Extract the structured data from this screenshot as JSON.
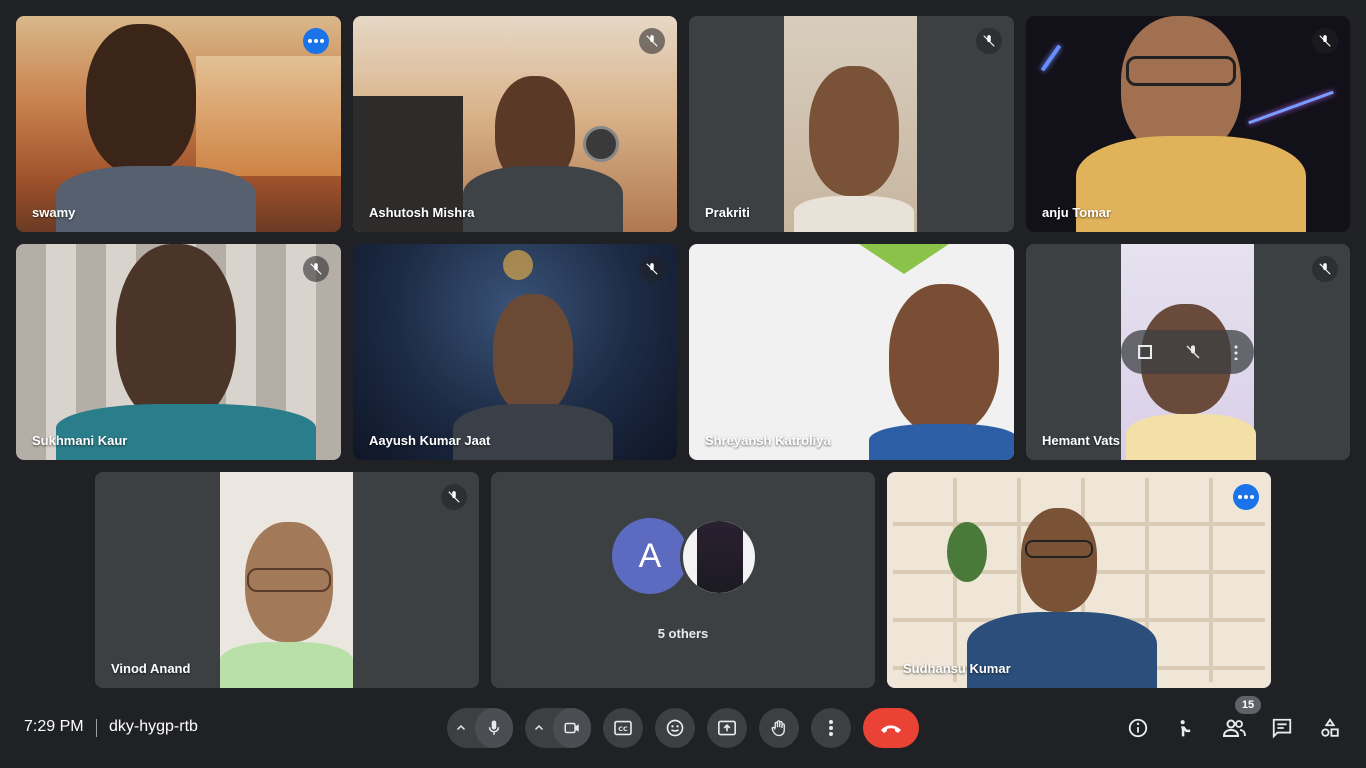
{
  "participants": {
    "swamy": "swamy",
    "ashutosh": "Ashutosh Mishra",
    "prakriti": "Prakriti",
    "anju": "anju Tomar",
    "sukhmani": "Sukhmani Kaur",
    "aayush": "Aayush Kumar Jaat",
    "shreyansh": "Shreyansh Katroliya",
    "hemant": "Hemant Vats",
    "vinod": "Vinod Anand",
    "others_label": "5 others",
    "others_avatar_letter": "A",
    "sudhansu": "Sudhansu Kumar"
  },
  "meeting": {
    "time": "7:29 PM",
    "code": "dky-hygp-rtb",
    "participant_count": "15"
  },
  "controls": {
    "mic": "mic-icon",
    "camera": "camera-icon",
    "captions": "captions-icon",
    "reactions": "emoji-icon",
    "present": "present-icon",
    "raise_hand": "hand-icon",
    "more": "more-vert-icon",
    "end_call": "end-call-icon",
    "info": "info-icon",
    "host": "host-controls-icon",
    "people": "people-icon",
    "chat": "chat-icon",
    "activities": "activities-icon"
  },
  "colors": {
    "background": "#202124",
    "tile": "#3c4043",
    "accent": "#8ab4f8",
    "end": "#ea4335",
    "avatar": "#5c6bc0"
  }
}
